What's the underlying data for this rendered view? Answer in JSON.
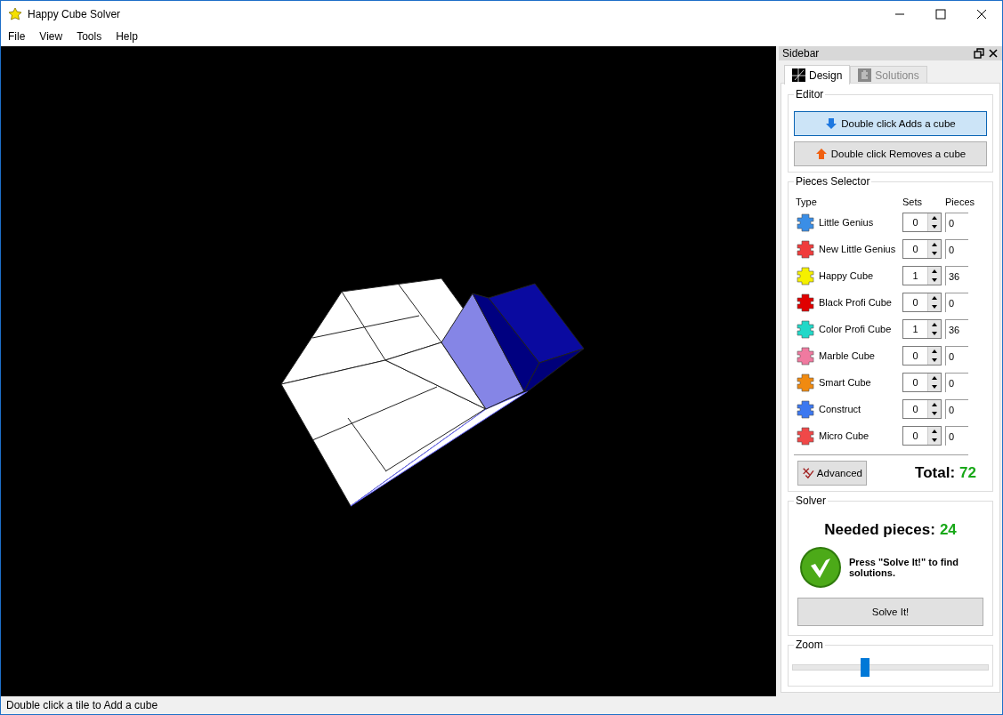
{
  "window": {
    "title": "Happy Cube Solver"
  },
  "menu": [
    "File",
    "View",
    "Tools",
    "Help"
  ],
  "sidebar": {
    "title": "Sidebar",
    "tabs": [
      {
        "label": "Design",
        "selected": true
      },
      {
        "label": "Solutions",
        "selected": false
      }
    ],
    "editor": {
      "title": "Editor",
      "buttons": [
        {
          "label": "Double click Adds a cube",
          "kind": "add",
          "selected": true
        },
        {
          "label": "Double click Removes a cube",
          "kind": "remove",
          "selected": false
        }
      ]
    },
    "pieces_selector": {
      "title": "Pieces Selector",
      "columns": [
        "Type",
        "Sets",
        "Pieces"
      ],
      "rows": [
        {
          "name": "Little Genius",
          "color": "#3a8ee6",
          "sets": "0",
          "pieces": "0"
        },
        {
          "name": "New Little Genius",
          "color": "#f03c3c",
          "sets": "0",
          "pieces": "0"
        },
        {
          "name": "Happy Cube",
          "color": "#f5f000",
          "sets": "1",
          "pieces": "36"
        },
        {
          "name": "Black Profi Cube",
          "color": "#e00000",
          "sets": "0",
          "pieces": "0"
        },
        {
          "name": "Color Profi Cube",
          "color": "#22d8c8",
          "sets": "1",
          "pieces": "36"
        },
        {
          "name": "Marble Cube",
          "color": "#f07aa0",
          "sets": "0",
          "pieces": "0"
        },
        {
          "name": "Smart Cube",
          "color": "#f08a10",
          "sets": "0",
          "pieces": "0"
        },
        {
          "name": "Construct",
          "color": "#3c78f0",
          "sets": "0",
          "pieces": "0"
        },
        {
          "name": "Micro Cube",
          "color": "#f04848",
          "sets": "0",
          "pieces": "0"
        }
      ],
      "advanced_button": "Advanced",
      "total_label": "Total:",
      "total_value": "72"
    },
    "solver": {
      "title": "Solver",
      "needed_label": "Needed pieces:",
      "needed_value": "24",
      "message": "Press \"Solve It!\" to find solutions.",
      "button": "Solve It!"
    },
    "zoom": {
      "title": "Zoom",
      "level": 0.35
    }
  },
  "status_bar": "Double click a tile to Add a cube"
}
